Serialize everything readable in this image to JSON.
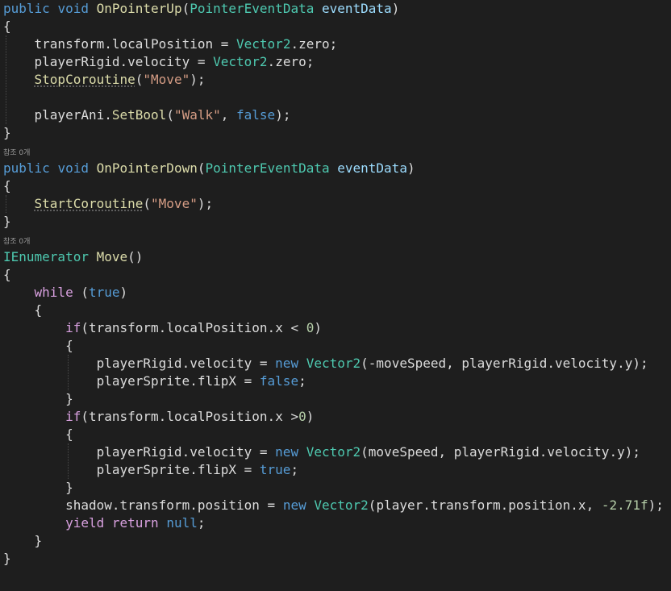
{
  "editor": {
    "theme": {
      "background": "#1e1e1e",
      "keyword": "#569cd6",
      "control": "#d8a0df",
      "type": "#4ec9b0",
      "method": "#dcdcaa",
      "string": "#d69d85",
      "number": "#b5cea8",
      "identifier": "#dcdcdc",
      "codelens": "#999999"
    },
    "lines": [
      {
        "kind": "code",
        "tokens": [
          {
            "t": "public",
            "c": "kw"
          },
          {
            "t": " ",
            "c": "plain"
          },
          {
            "t": "void",
            "c": "kw"
          },
          {
            "t": " ",
            "c": "plain"
          },
          {
            "t": "OnPointerUp",
            "c": "method"
          },
          {
            "t": "(",
            "c": "plain"
          },
          {
            "t": "PointerEventData",
            "c": "type"
          },
          {
            "t": " ",
            "c": "plain"
          },
          {
            "t": "eventData",
            "c": "local"
          },
          {
            "t": ")",
            "c": "plain"
          }
        ]
      },
      {
        "kind": "code",
        "tokens": [
          {
            "t": "{",
            "c": "plain"
          }
        ]
      },
      {
        "kind": "code",
        "tokens": [
          {
            "t": "    ",
            "c": "plain"
          },
          {
            "t": "transform",
            "c": "id"
          },
          {
            "t": ".",
            "c": "plain"
          },
          {
            "t": "localPosition",
            "c": "id"
          },
          {
            "t": " = ",
            "c": "plain"
          },
          {
            "t": "Vector2",
            "c": "type"
          },
          {
            "t": ".",
            "c": "plain"
          },
          {
            "t": "zero",
            "c": "id"
          },
          {
            "t": ";",
            "c": "plain"
          }
        ]
      },
      {
        "kind": "code",
        "tokens": [
          {
            "t": "    ",
            "c": "plain"
          },
          {
            "t": "playerRigid",
            "c": "id"
          },
          {
            "t": ".",
            "c": "plain"
          },
          {
            "t": "velocity",
            "c": "id"
          },
          {
            "t": " = ",
            "c": "plain"
          },
          {
            "t": "Vector2",
            "c": "type"
          },
          {
            "t": ".",
            "c": "plain"
          },
          {
            "t": "zero",
            "c": "id"
          },
          {
            "t": ";",
            "c": "plain"
          }
        ]
      },
      {
        "kind": "code",
        "tokens": [
          {
            "t": "    ",
            "c": "plain"
          },
          {
            "t": "StopCoroutine",
            "c": "method",
            "u": true
          },
          {
            "t": "(",
            "c": "plain"
          },
          {
            "t": "\"Move\"",
            "c": "str"
          },
          {
            "t": ");",
            "c": "plain"
          }
        ]
      },
      {
        "kind": "code",
        "tokens": [
          {
            "t": "",
            "c": "plain"
          }
        ]
      },
      {
        "kind": "code",
        "tokens": [
          {
            "t": "    ",
            "c": "plain"
          },
          {
            "t": "playerAni",
            "c": "id"
          },
          {
            "t": ".",
            "c": "plain"
          },
          {
            "t": "SetBool",
            "c": "method"
          },
          {
            "t": "(",
            "c": "plain"
          },
          {
            "t": "\"Walk\"",
            "c": "str"
          },
          {
            "t": ", ",
            "c": "plain"
          },
          {
            "t": "false",
            "c": "kw"
          },
          {
            "t": ");",
            "c": "plain"
          }
        ]
      },
      {
        "kind": "code",
        "tokens": [
          {
            "t": "}",
            "c": "plain"
          }
        ]
      },
      {
        "kind": "gap"
      },
      {
        "kind": "lens",
        "text": "참조 0개"
      },
      {
        "kind": "code",
        "tokens": [
          {
            "t": "public",
            "c": "kw"
          },
          {
            "t": " ",
            "c": "plain"
          },
          {
            "t": "void",
            "c": "kw"
          },
          {
            "t": " ",
            "c": "plain"
          },
          {
            "t": "OnPointerDown",
            "c": "method"
          },
          {
            "t": "(",
            "c": "plain"
          },
          {
            "t": "PointerEventData",
            "c": "type"
          },
          {
            "t": " ",
            "c": "plain"
          },
          {
            "t": "eventData",
            "c": "local"
          },
          {
            "t": ")",
            "c": "plain"
          }
        ]
      },
      {
        "kind": "code",
        "tokens": [
          {
            "t": "{",
            "c": "plain"
          }
        ]
      },
      {
        "kind": "code",
        "tokens": [
          {
            "t": "    ",
            "c": "plain"
          },
          {
            "t": "StartCoroutine",
            "c": "method",
            "u": true
          },
          {
            "t": "(",
            "c": "plain"
          },
          {
            "t": "\"Move\"",
            "c": "str"
          },
          {
            "t": ");",
            "c": "plain"
          }
        ]
      },
      {
        "kind": "code",
        "tokens": [
          {
            "t": "}",
            "c": "plain"
          }
        ]
      },
      {
        "kind": "gap"
      },
      {
        "kind": "lens",
        "text": "참조 0개"
      },
      {
        "kind": "code",
        "tokens": [
          {
            "t": "IEnumerator",
            "c": "type"
          },
          {
            "t": " ",
            "c": "plain"
          },
          {
            "t": "Move",
            "c": "method"
          },
          {
            "t": "()",
            "c": "plain"
          }
        ]
      },
      {
        "kind": "code",
        "tokens": [
          {
            "t": "{",
            "c": "plain"
          }
        ]
      },
      {
        "kind": "code",
        "tokens": [
          {
            "t": "    ",
            "c": "plain"
          },
          {
            "t": "while",
            "c": "ctrl"
          },
          {
            "t": " (",
            "c": "plain"
          },
          {
            "t": "true",
            "c": "kw"
          },
          {
            "t": ")",
            "c": "plain"
          }
        ]
      },
      {
        "kind": "code",
        "tokens": [
          {
            "t": "    {",
            "c": "plain"
          }
        ]
      },
      {
        "kind": "code",
        "tokens": [
          {
            "t": "        ",
            "c": "plain"
          },
          {
            "t": "if",
            "c": "ctrl"
          },
          {
            "t": "(",
            "c": "plain"
          },
          {
            "t": "transform",
            "c": "id"
          },
          {
            "t": ".",
            "c": "plain"
          },
          {
            "t": "localPosition",
            "c": "id"
          },
          {
            "t": ".",
            "c": "plain"
          },
          {
            "t": "x",
            "c": "id"
          },
          {
            "t": " < ",
            "c": "plain"
          },
          {
            "t": "0",
            "c": "num"
          },
          {
            "t": ")",
            "c": "plain"
          }
        ]
      },
      {
        "kind": "code",
        "tokens": [
          {
            "t": "        {",
            "c": "plain"
          }
        ]
      },
      {
        "kind": "code",
        "tokens": [
          {
            "t": "            ",
            "c": "plain"
          },
          {
            "t": "playerRigid",
            "c": "id"
          },
          {
            "t": ".",
            "c": "plain"
          },
          {
            "t": "velocity",
            "c": "id"
          },
          {
            "t": " = ",
            "c": "plain"
          },
          {
            "t": "new",
            "c": "kw"
          },
          {
            "t": " ",
            "c": "plain"
          },
          {
            "t": "Vector2",
            "c": "type"
          },
          {
            "t": "(-",
            "c": "plain"
          },
          {
            "t": "moveSpeed",
            "c": "id"
          },
          {
            "t": ", ",
            "c": "plain"
          },
          {
            "t": "playerRigid",
            "c": "id"
          },
          {
            "t": ".",
            "c": "plain"
          },
          {
            "t": "velocity",
            "c": "id"
          },
          {
            "t": ".",
            "c": "plain"
          },
          {
            "t": "y",
            "c": "id"
          },
          {
            "t": ");",
            "c": "plain"
          }
        ]
      },
      {
        "kind": "code",
        "tokens": [
          {
            "t": "            ",
            "c": "plain"
          },
          {
            "t": "playerSprite",
            "c": "id"
          },
          {
            "t": ".",
            "c": "plain"
          },
          {
            "t": "flipX",
            "c": "id"
          },
          {
            "t": " = ",
            "c": "plain"
          },
          {
            "t": "false",
            "c": "kw"
          },
          {
            "t": ";",
            "c": "plain"
          }
        ]
      },
      {
        "kind": "code",
        "tokens": [
          {
            "t": "        }",
            "c": "plain"
          }
        ]
      },
      {
        "kind": "code",
        "tokens": [
          {
            "t": "        ",
            "c": "plain"
          },
          {
            "t": "if",
            "c": "ctrl"
          },
          {
            "t": "(",
            "c": "plain"
          },
          {
            "t": "transform",
            "c": "id"
          },
          {
            "t": ".",
            "c": "plain"
          },
          {
            "t": "localPosition",
            "c": "id"
          },
          {
            "t": ".",
            "c": "plain"
          },
          {
            "t": "x",
            "c": "id"
          },
          {
            "t": " >",
            "c": "plain"
          },
          {
            "t": "0",
            "c": "num"
          },
          {
            "t": ")",
            "c": "plain"
          }
        ]
      },
      {
        "kind": "code",
        "tokens": [
          {
            "t": "        {",
            "c": "plain"
          }
        ]
      },
      {
        "kind": "code",
        "tokens": [
          {
            "t": "            ",
            "c": "plain"
          },
          {
            "t": "playerRigid",
            "c": "id"
          },
          {
            "t": ".",
            "c": "plain"
          },
          {
            "t": "velocity",
            "c": "id"
          },
          {
            "t": " = ",
            "c": "plain"
          },
          {
            "t": "new",
            "c": "kw"
          },
          {
            "t": " ",
            "c": "plain"
          },
          {
            "t": "Vector2",
            "c": "type"
          },
          {
            "t": "(",
            "c": "plain"
          },
          {
            "t": "moveSpeed",
            "c": "id"
          },
          {
            "t": ", ",
            "c": "plain"
          },
          {
            "t": "playerRigid",
            "c": "id"
          },
          {
            "t": ".",
            "c": "plain"
          },
          {
            "t": "velocity",
            "c": "id"
          },
          {
            "t": ".",
            "c": "plain"
          },
          {
            "t": "y",
            "c": "id"
          },
          {
            "t": ");",
            "c": "plain"
          }
        ]
      },
      {
        "kind": "code",
        "tokens": [
          {
            "t": "            ",
            "c": "plain"
          },
          {
            "t": "playerSprite",
            "c": "id"
          },
          {
            "t": ".",
            "c": "plain"
          },
          {
            "t": "flipX",
            "c": "id"
          },
          {
            "t": " = ",
            "c": "plain"
          },
          {
            "t": "true",
            "c": "kw"
          },
          {
            "t": ";",
            "c": "plain"
          }
        ]
      },
      {
        "kind": "code",
        "tokens": [
          {
            "t": "        }",
            "c": "plain"
          }
        ]
      },
      {
        "kind": "code",
        "tokens": [
          {
            "t": "        ",
            "c": "plain"
          },
          {
            "t": "shadow",
            "c": "id"
          },
          {
            "t": ".",
            "c": "plain"
          },
          {
            "t": "transform",
            "c": "id"
          },
          {
            "t": ".",
            "c": "plain"
          },
          {
            "t": "position",
            "c": "id"
          },
          {
            "t": " = ",
            "c": "plain"
          },
          {
            "t": "new",
            "c": "kw"
          },
          {
            "t": " ",
            "c": "plain"
          },
          {
            "t": "Vector2",
            "c": "type"
          },
          {
            "t": "(",
            "c": "plain"
          },
          {
            "t": "player",
            "c": "id"
          },
          {
            "t": ".",
            "c": "plain"
          },
          {
            "t": "transform",
            "c": "id"
          },
          {
            "t": ".",
            "c": "plain"
          },
          {
            "t": "position",
            "c": "id"
          },
          {
            "t": ".",
            "c": "plain"
          },
          {
            "t": "x",
            "c": "id"
          },
          {
            "t": ", ",
            "c": "plain"
          },
          {
            "t": "-2.71f",
            "c": "num"
          },
          {
            "t": ");",
            "c": "plain"
          }
        ]
      },
      {
        "kind": "code",
        "tokens": [
          {
            "t": "        ",
            "c": "plain"
          },
          {
            "t": "yield",
            "c": "ctrl"
          },
          {
            "t": " ",
            "c": "plain"
          },
          {
            "t": "return",
            "c": "ctrl"
          },
          {
            "t": " ",
            "c": "plain"
          },
          {
            "t": "null",
            "c": "kw"
          },
          {
            "t": ";",
            "c": "plain"
          }
        ]
      },
      {
        "kind": "code",
        "tokens": [
          {
            "t": "    }",
            "c": "plain"
          }
        ]
      },
      {
        "kind": "code",
        "tokens": [
          {
            "t": "}",
            "c": "plain"
          }
        ]
      }
    ]
  }
}
